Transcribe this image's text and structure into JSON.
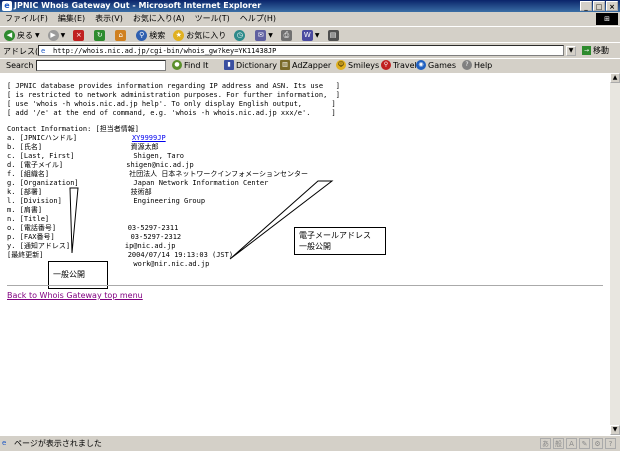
{
  "window": {
    "title": "JPNIC Whois Gateway Out - Microsoft Internet Explorer",
    "icon": "ie-icon",
    "controls": [
      "_",
      "□",
      "×"
    ]
  },
  "menu": [
    "ファイル(F)",
    "編集(E)",
    "表示(V)",
    "お気に入り(A)",
    "ツール(T)",
    "ヘルプ(H)"
  ],
  "toolbar": {
    "back": "戻る",
    "search": "検索",
    "favorites": "お気に入り"
  },
  "address": {
    "label": "アドレス(D)",
    "url": "http://whois.nic.ad.jp/cgi-bin/whois_gw?key=YK11438JP",
    "go": "移動"
  },
  "searchbar": {
    "label": "Search",
    "items": [
      {
        "label": "Find It",
        "icon": "find-icon",
        "color": "#5a8f2a"
      },
      {
        "label": "Dictionary",
        "icon": "book-icon",
        "color": "#3a4fa0"
      },
      {
        "label": "AdZapper",
        "icon": "adzapper-icon",
        "color": "#7a6a2a"
      },
      {
        "label": "Smileys",
        "icon": "smiley-icon",
        "color": "#e0b020"
      },
      {
        "label": "Travel",
        "icon": "pin-icon",
        "color": "#c02020"
      },
      {
        "label": "Games",
        "icon": "games-icon",
        "color": "#2060c0"
      },
      {
        "label": "Help",
        "icon": "help-icon",
        "color": "#808080"
      }
    ]
  },
  "content": {
    "notice": "[ JPNIC database provides information regarding IP address and ASN. Its use   ]\n[ is restricted to network administration purposes. For further information,  ]\n[ use 'whois -h whois.nic.ad.jp help'. To only display English output,       ]\n[ add '/e' at the end of command, e.g. 'whois -h whois.nic.ad.jp xxx/e'.     ]",
    "contact_header": "Contact Information: [担当者情報]",
    "handle_label": "a. [JPNICハンドル]             ",
    "handle_value": "XY9999JP",
    "contact_rest": "b. [氏名]                     資源太郎\nc. [Last, First]              Shigen, Taro\nd. [電子メイル]               shigen@nic.ad.jp\nf. [組織名]                   社団法人 日本ネットワークインフォメーションセンター\ng. [Organization]             Japan Network Information Center\nk. [部署]                     技術部\nl. [Division]                 Engineering Group\nm. [肩書]\nn. [Title]\no. [電話番号]                 03-5297-2311\np. [FAX番号]                  03-5297-2312\ny. [通知アドレス]             ip@nic.ad.jp\n[最終更新]                    2004/07/14 19:13:03 (JST)\n                              work@nir.nic.ad.jp",
    "back_link": "Back to Whois Gateway top menu"
  },
  "callouts": {
    "email": {
      "line1": "電子メールアドレス",
      "line2": "一般公開"
    },
    "public": "一般公開"
  },
  "status": {
    "text": "ページが表示されました"
  }
}
